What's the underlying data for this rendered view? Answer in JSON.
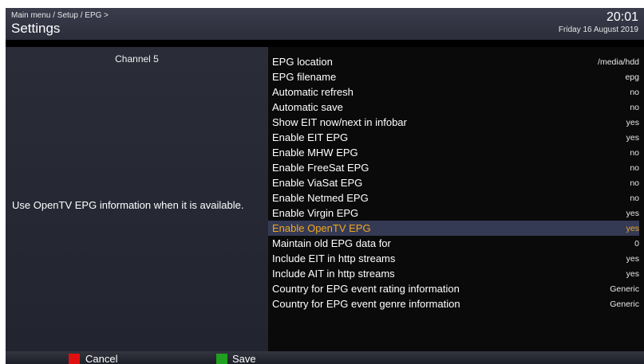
{
  "header": {
    "breadcrumb": "Main menu / Setup / EPG >",
    "title": "Settings",
    "time": "20:01",
    "date": "Friday 16 August 2019"
  },
  "left_panel": {
    "channel": "Channel 5",
    "description": "Use OpenTV EPG information when it is available."
  },
  "settings": [
    {
      "label": "EPG location",
      "value": "/media/hdd"
    },
    {
      "label": "EPG filename",
      "value": "epg"
    },
    {
      "label": "Automatic refresh",
      "value": "no"
    },
    {
      "label": "Automatic save",
      "value": "no"
    },
    {
      "label": "Show EIT now/next in infobar",
      "value": "yes"
    },
    {
      "label": "Enable EIT EPG",
      "value": "yes"
    },
    {
      "label": "Enable MHW EPG",
      "value": "no"
    },
    {
      "label": "Enable FreeSat EPG",
      "value": "no"
    },
    {
      "label": "Enable ViaSat EPG",
      "value": "no"
    },
    {
      "label": "Enable Netmed EPG",
      "value": "no"
    },
    {
      "label": "Enable Virgin EPG",
      "value": "yes"
    },
    {
      "label": "Enable OpenTV EPG",
      "value": "yes"
    },
    {
      "label": "Maintain old EPG data for",
      "value": "0"
    },
    {
      "label": "Include EIT in http streams",
      "value": "yes"
    },
    {
      "label": "Include AIT in http streams",
      "value": "yes"
    },
    {
      "label": "Country for EPG event rating information",
      "value": "Generic"
    },
    {
      "label": "Country for EPG event genre information",
      "value": "Generic"
    }
  ],
  "selected_index": 11,
  "footer": {
    "cancel_label": "Cancel",
    "save_label": "Save",
    "cancel_color": "#e01010",
    "save_color": "#20a020"
  },
  "colors": {
    "highlight_background": "#353a54",
    "highlight_text": "#f0a820"
  }
}
